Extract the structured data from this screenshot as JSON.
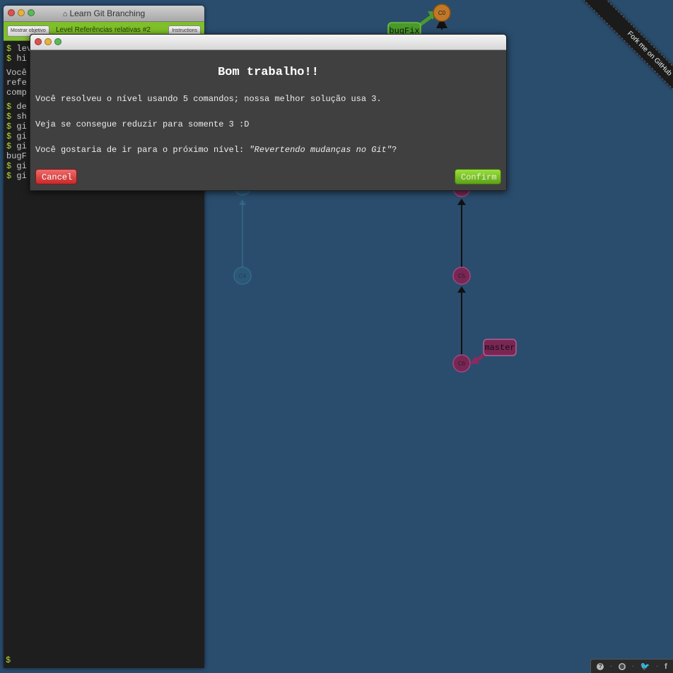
{
  "terminal": {
    "window_title": "Learn Git Branching",
    "toolbar": {
      "show_objective_label": "Mostrar objetivo",
      "level_label": "Level Referências relativas #2",
      "instructions_label": "Instructions"
    },
    "lines": [
      {
        "prompt": "$",
        "text": " lev"
      },
      {
        "prompt": "$",
        "text": " hi"
      },
      {
        "prompt": "",
        "text": "Você"
      },
      {
        "prompt": "",
        "text": "refe"
      },
      {
        "prompt": "",
        "text": "comp"
      },
      {
        "prompt": "$",
        "text": " de"
      },
      {
        "prompt": "$",
        "text": " sh"
      },
      {
        "prompt": "$",
        "text": " gi"
      },
      {
        "prompt": "$",
        "text": " gi"
      },
      {
        "prompt": "$",
        "text": " gi"
      },
      {
        "prompt": "",
        "text": "bugF"
      },
      {
        "prompt": "$",
        "text": " gi"
      },
      {
        "prompt": "$",
        "text": " gi"
      }
    ],
    "input_prompt": "$"
  },
  "git_tree": {
    "commits": [
      {
        "id": "C0",
        "label": "C0",
        "color": "#c07828",
        "faded": false
      },
      {
        "id": "C4",
        "label": "C4",
        "color": "#2a6f86",
        "faded": true
      },
      {
        "id": "C5",
        "label": "C5",
        "color": "#7a2655",
        "faded": false
      },
      {
        "id": "C6",
        "label": "C6",
        "color": "#7a2655",
        "faded": false
      }
    ],
    "branches": [
      {
        "name": "bugFix",
        "color": "#4a9a2a"
      },
      {
        "name": "master",
        "color": "#7a2655"
      }
    ]
  },
  "ribbon": {
    "text": "Fork me on GitHub"
  },
  "footer": {
    "help_icon": "question-icon",
    "globe_icon": "globe-icon",
    "twitter_icon": "twitter-icon",
    "facebook_icon": "facebook-icon",
    "separator": "·"
  },
  "modal": {
    "heading": "Bom trabalho!!",
    "message_1": "Você resolveu o nível usando 5 comandos; nossa melhor solução usa 3.",
    "message_2": "Veja se consegue reduzir para somente 3 :D",
    "message_3_prefix": "Você gostaria de ir para o próximo nível: ",
    "message_3_level": "\"Revertendo mudanças no Git\"",
    "message_3_suffix": "?",
    "cancel_label": "Cancel",
    "confirm_label": "Confirm"
  }
}
